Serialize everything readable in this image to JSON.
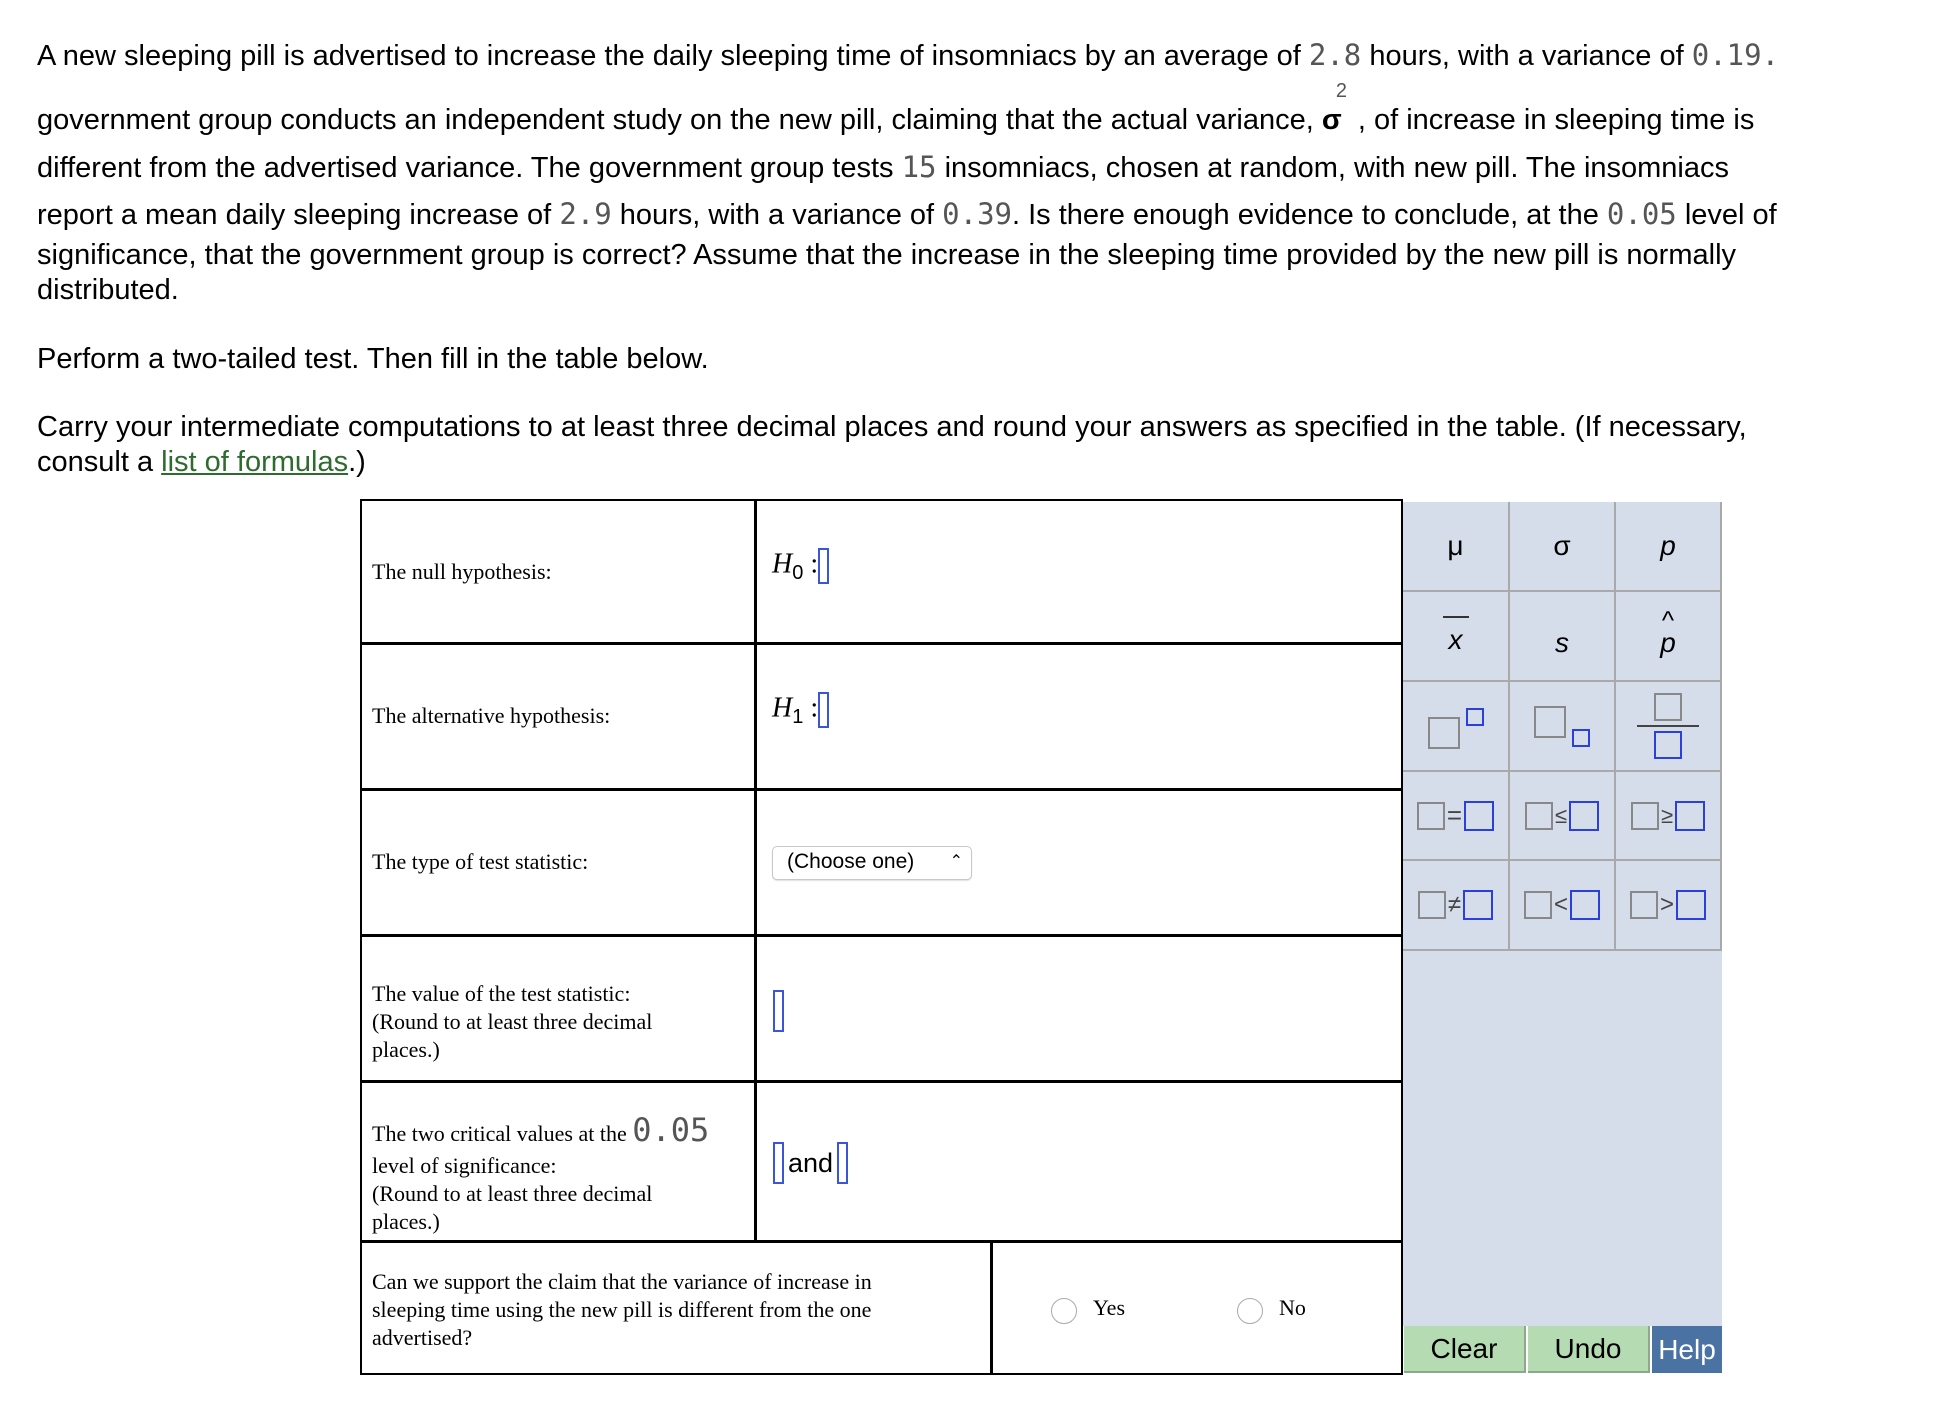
{
  "problem": {
    "line1_a": "A new sleeping pill is advertised to increase the daily sleeping time of insomniacs by an average of",
    "mean_advertised": "2.8",
    "line1_b": "hours, with a variance of",
    "variance_advertised": "0.19",
    "line1_c": ".",
    "line2_a": "government group conducts an independent study on the new pill, claiming that the actual variance,",
    "sigma_symbol": "σ",
    "sigma_exponent": "2",
    "line2_b": ", of increase in sleeping time is",
    "line3_a": "different from the advertised variance. The government group tests",
    "sample_size": "15",
    "line3_b": "insomniacs, chosen at random, with new pill. The insomniacs",
    "line4_a": "report a mean daily sleeping increase of",
    "sample_mean": "2.9",
    "line4_b": "hours, with a variance of",
    "sample_variance": "0.39",
    "line4_c": ". Is there enough evidence to conclude, at the",
    "alpha": "0.05",
    "line4_d": "level of",
    "line5": "significance, that the government group is correct? Assume that the increase in the sleeping time provided by the new pill is normally",
    "line6": "distributed.",
    "instruction1": "Perform a two-tailed test. Then fill in the table below.",
    "instruction2": "Carry your intermediate computations to at least three decimal places and round your answers as specified in the table. (If necessary,",
    "instruction3_a": "consult a",
    "formulas_link": "list of formulas",
    "instruction3_b": ".)"
  },
  "table": {
    "null_label": "The null hypothesis:",
    "null_symbol": "H",
    "null_sub": "0",
    "alt_label": "The alternative hypothesis:",
    "alt_symbol": "H",
    "alt_sub": "1",
    "colon": ":",
    "type_label": "The type of test statistic:",
    "type_select": "(Choose one)",
    "value_label_1": "The value of the test statistic:",
    "value_label_2": "(Round to at least three decimal",
    "value_label_3": "places.)",
    "crit_label_1": "The two critical values at the",
    "crit_alpha": "0.05",
    "crit_label_2": "level of significance:",
    "crit_label_3": "(Round to at least three decimal",
    "crit_label_4": "places.)",
    "and": "and",
    "support_label_1": "Can we support the claim that the variance of increase in",
    "support_label_2": "sleeping time using the new pill is different from the one",
    "support_label_3": "advertised?",
    "yes": "Yes",
    "no": "No"
  },
  "palette": {
    "mu": "μ",
    "sigma": "σ",
    "p": "p",
    "xbar": "x",
    "s": "s",
    "phat": "p",
    "eq": "=",
    "le": "≤",
    "ge": "≥",
    "ne": "≠",
    "lt": "<",
    "gt": ">",
    "clear": "Clear",
    "undo": "Undo",
    "help": "Help"
  },
  "colors": {
    "palette_bg": "#d5dcea",
    "action_green": "#b5dbb2",
    "help_blue": "#4a73a3",
    "input_blue": "#3a55d6",
    "link_green": "#2e6b2e"
  }
}
